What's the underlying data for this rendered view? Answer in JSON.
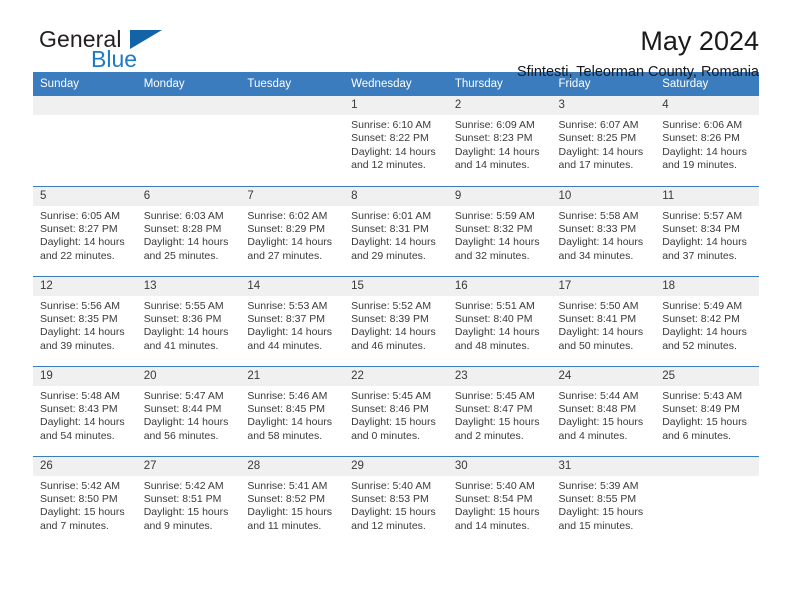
{
  "brand": {
    "name_primary": "General",
    "name_secondary": "Blue",
    "accent_color": "#1363a8",
    "secondary_color": "#1f7ac4"
  },
  "header": {
    "title": "May 2024",
    "subtitle": "Sfintesti, Teleorman County, Romania"
  },
  "theme": {
    "header_row_bg": "#3a7cbe",
    "daynum_bg": "#f0f0f0",
    "rule_color": "#3a7cbe",
    "text_color": "#3a3a3a"
  },
  "calendar": {
    "weekday_headers": [
      "Sunday",
      "Monday",
      "Tuesday",
      "Wednesday",
      "Thursday",
      "Friday",
      "Saturday"
    ],
    "weeks": [
      [
        {
          "day": "",
          "empty": true,
          "sunrise": "",
          "sunset": "",
          "daylight_line1": "",
          "daylight_line2": ""
        },
        {
          "day": "",
          "empty": true,
          "sunrise": "",
          "sunset": "",
          "daylight_line1": "",
          "daylight_line2": ""
        },
        {
          "day": "",
          "empty": true,
          "sunrise": "",
          "sunset": "",
          "daylight_line1": "",
          "daylight_line2": ""
        },
        {
          "day": "1",
          "sunrise": "Sunrise: 6:10 AM",
          "sunset": "Sunset: 8:22 PM",
          "daylight_line1": "Daylight: 14 hours",
          "daylight_line2": "and 12 minutes."
        },
        {
          "day": "2",
          "sunrise": "Sunrise: 6:09 AM",
          "sunset": "Sunset: 8:23 PM",
          "daylight_line1": "Daylight: 14 hours",
          "daylight_line2": "and 14 minutes."
        },
        {
          "day": "3",
          "sunrise": "Sunrise: 6:07 AM",
          "sunset": "Sunset: 8:25 PM",
          "daylight_line1": "Daylight: 14 hours",
          "daylight_line2": "and 17 minutes."
        },
        {
          "day": "4",
          "sunrise": "Sunrise: 6:06 AM",
          "sunset": "Sunset: 8:26 PM",
          "daylight_line1": "Daylight: 14 hours",
          "daylight_line2": "and 19 minutes."
        }
      ],
      [
        {
          "day": "5",
          "sunrise": "Sunrise: 6:05 AM",
          "sunset": "Sunset: 8:27 PM",
          "daylight_line1": "Daylight: 14 hours",
          "daylight_line2": "and 22 minutes."
        },
        {
          "day": "6",
          "sunrise": "Sunrise: 6:03 AM",
          "sunset": "Sunset: 8:28 PM",
          "daylight_line1": "Daylight: 14 hours",
          "daylight_line2": "and 25 minutes."
        },
        {
          "day": "7",
          "sunrise": "Sunrise: 6:02 AM",
          "sunset": "Sunset: 8:29 PM",
          "daylight_line1": "Daylight: 14 hours",
          "daylight_line2": "and 27 minutes."
        },
        {
          "day": "8",
          "sunrise": "Sunrise: 6:01 AM",
          "sunset": "Sunset: 8:31 PM",
          "daylight_line1": "Daylight: 14 hours",
          "daylight_line2": "and 29 minutes."
        },
        {
          "day": "9",
          "sunrise": "Sunrise: 5:59 AM",
          "sunset": "Sunset: 8:32 PM",
          "daylight_line1": "Daylight: 14 hours",
          "daylight_line2": "and 32 minutes."
        },
        {
          "day": "10",
          "sunrise": "Sunrise: 5:58 AM",
          "sunset": "Sunset: 8:33 PM",
          "daylight_line1": "Daylight: 14 hours",
          "daylight_line2": "and 34 minutes."
        },
        {
          "day": "11",
          "sunrise": "Sunrise: 5:57 AM",
          "sunset": "Sunset: 8:34 PM",
          "daylight_line1": "Daylight: 14 hours",
          "daylight_line2": "and 37 minutes."
        }
      ],
      [
        {
          "day": "12",
          "sunrise": "Sunrise: 5:56 AM",
          "sunset": "Sunset: 8:35 PM",
          "daylight_line1": "Daylight: 14 hours",
          "daylight_line2": "and 39 minutes."
        },
        {
          "day": "13",
          "sunrise": "Sunrise: 5:55 AM",
          "sunset": "Sunset: 8:36 PM",
          "daylight_line1": "Daylight: 14 hours",
          "daylight_line2": "and 41 minutes."
        },
        {
          "day": "14",
          "sunrise": "Sunrise: 5:53 AM",
          "sunset": "Sunset: 8:37 PM",
          "daylight_line1": "Daylight: 14 hours",
          "daylight_line2": "and 44 minutes."
        },
        {
          "day": "15",
          "sunrise": "Sunrise: 5:52 AM",
          "sunset": "Sunset: 8:39 PM",
          "daylight_line1": "Daylight: 14 hours",
          "daylight_line2": "and 46 minutes."
        },
        {
          "day": "16",
          "sunrise": "Sunrise: 5:51 AM",
          "sunset": "Sunset: 8:40 PM",
          "daylight_line1": "Daylight: 14 hours",
          "daylight_line2": "and 48 minutes."
        },
        {
          "day": "17",
          "sunrise": "Sunrise: 5:50 AM",
          "sunset": "Sunset: 8:41 PM",
          "daylight_line1": "Daylight: 14 hours",
          "daylight_line2": "and 50 minutes."
        },
        {
          "day": "18",
          "sunrise": "Sunrise: 5:49 AM",
          "sunset": "Sunset: 8:42 PM",
          "daylight_line1": "Daylight: 14 hours",
          "daylight_line2": "and 52 minutes."
        }
      ],
      [
        {
          "day": "19",
          "sunrise": "Sunrise: 5:48 AM",
          "sunset": "Sunset: 8:43 PM",
          "daylight_line1": "Daylight: 14 hours",
          "daylight_line2": "and 54 minutes."
        },
        {
          "day": "20",
          "sunrise": "Sunrise: 5:47 AM",
          "sunset": "Sunset: 8:44 PM",
          "daylight_line1": "Daylight: 14 hours",
          "daylight_line2": "and 56 minutes."
        },
        {
          "day": "21",
          "sunrise": "Sunrise: 5:46 AM",
          "sunset": "Sunset: 8:45 PM",
          "daylight_line1": "Daylight: 14 hours",
          "daylight_line2": "and 58 minutes."
        },
        {
          "day": "22",
          "sunrise": "Sunrise: 5:45 AM",
          "sunset": "Sunset: 8:46 PM",
          "daylight_line1": "Daylight: 15 hours",
          "daylight_line2": "and 0 minutes."
        },
        {
          "day": "23",
          "sunrise": "Sunrise: 5:45 AM",
          "sunset": "Sunset: 8:47 PM",
          "daylight_line1": "Daylight: 15 hours",
          "daylight_line2": "and 2 minutes."
        },
        {
          "day": "24",
          "sunrise": "Sunrise: 5:44 AM",
          "sunset": "Sunset: 8:48 PM",
          "daylight_line1": "Daylight: 15 hours",
          "daylight_line2": "and 4 minutes."
        },
        {
          "day": "25",
          "sunrise": "Sunrise: 5:43 AM",
          "sunset": "Sunset: 8:49 PM",
          "daylight_line1": "Daylight: 15 hours",
          "daylight_line2": "and 6 minutes."
        }
      ],
      [
        {
          "day": "26",
          "sunrise": "Sunrise: 5:42 AM",
          "sunset": "Sunset: 8:50 PM",
          "daylight_line1": "Daylight: 15 hours",
          "daylight_line2": "and 7 minutes."
        },
        {
          "day": "27",
          "sunrise": "Sunrise: 5:42 AM",
          "sunset": "Sunset: 8:51 PM",
          "daylight_line1": "Daylight: 15 hours",
          "daylight_line2": "and 9 minutes."
        },
        {
          "day": "28",
          "sunrise": "Sunrise: 5:41 AM",
          "sunset": "Sunset: 8:52 PM",
          "daylight_line1": "Daylight: 15 hours",
          "daylight_line2": "and 11 minutes."
        },
        {
          "day": "29",
          "sunrise": "Sunrise: 5:40 AM",
          "sunset": "Sunset: 8:53 PM",
          "daylight_line1": "Daylight: 15 hours",
          "daylight_line2": "and 12 minutes."
        },
        {
          "day": "30",
          "sunrise": "Sunrise: 5:40 AM",
          "sunset": "Sunset: 8:54 PM",
          "daylight_line1": "Daylight: 15 hours",
          "daylight_line2": "and 14 minutes."
        },
        {
          "day": "31",
          "sunrise": "Sunrise: 5:39 AM",
          "sunset": "Sunset: 8:55 PM",
          "daylight_line1": "Daylight: 15 hours",
          "daylight_line2": "and 15 minutes."
        },
        {
          "day": "",
          "empty": true,
          "sunrise": "",
          "sunset": "",
          "daylight_line1": "",
          "daylight_line2": ""
        }
      ]
    ]
  }
}
